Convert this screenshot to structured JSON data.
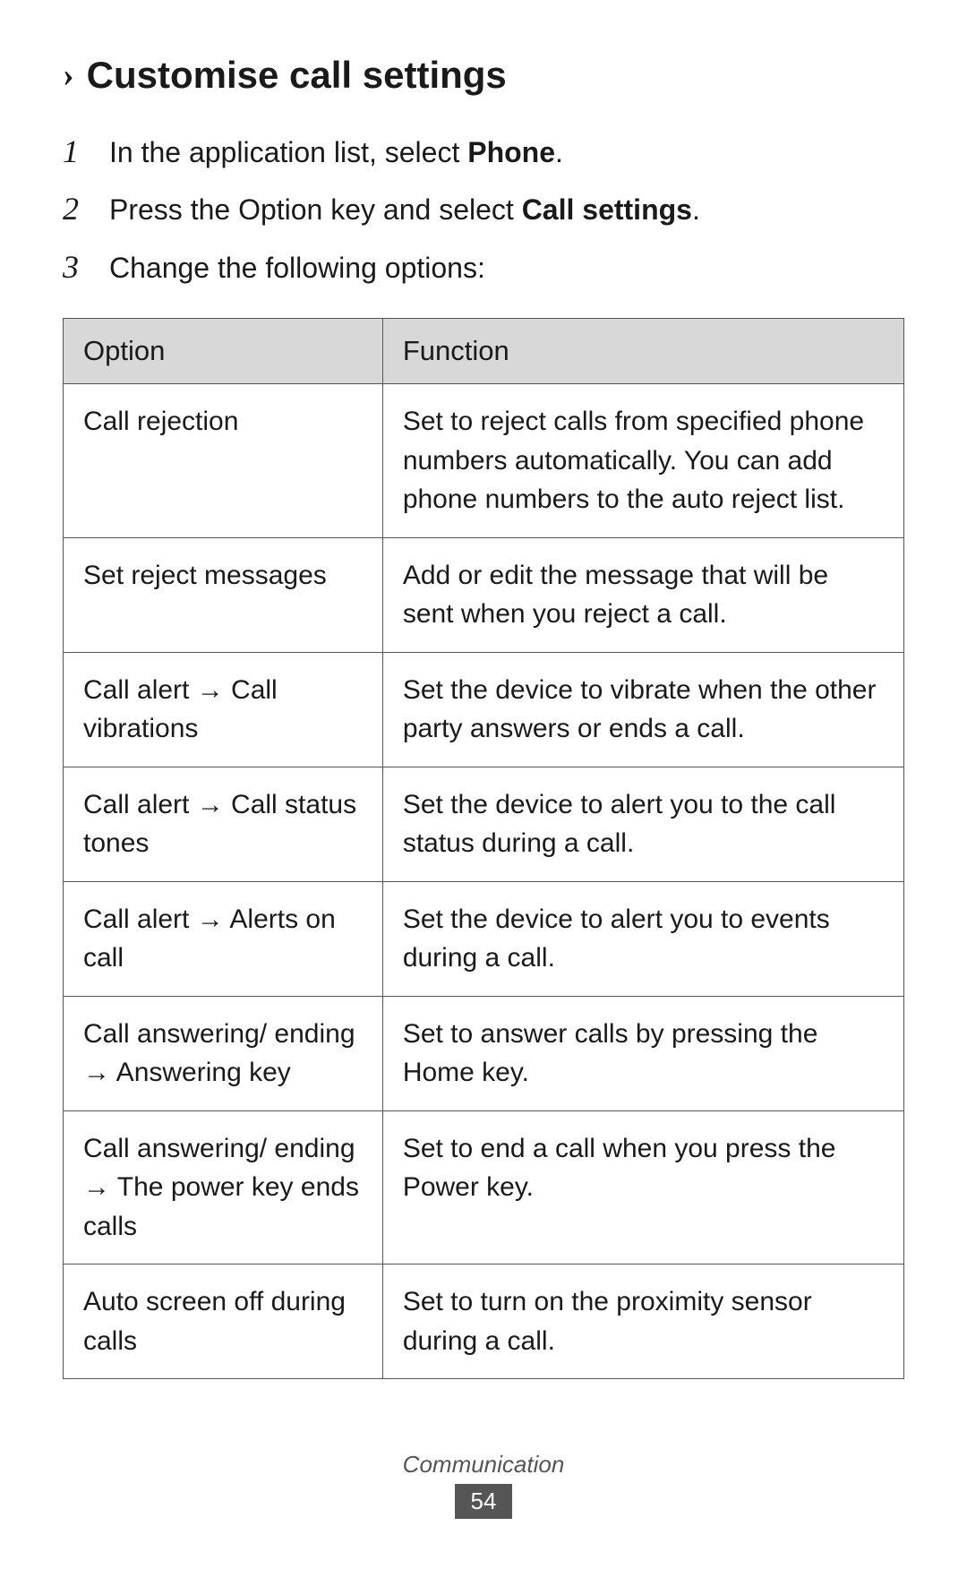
{
  "page": {
    "heading": {
      "chevron": "›",
      "title": "Customise call settings"
    },
    "steps": [
      {
        "number": "1",
        "text_before": "In the application list, select ",
        "bold": "Phone",
        "text_after": "."
      },
      {
        "number": "2",
        "text_before": "Press the Option key and select ",
        "bold": "Call settings",
        "text_after": "."
      },
      {
        "number": "3",
        "text_plain": "Change the following options:"
      }
    ],
    "table": {
      "headers": [
        "Option",
        "Function"
      ],
      "rows": [
        {
          "option": "Call rejection",
          "function": "Set to reject calls from specified phone numbers automatically. You can add phone numbers to the auto reject list."
        },
        {
          "option": "Set reject messages",
          "function": "Add or edit the message that will be sent when you reject a call."
        },
        {
          "option": "Call alert → Call vibrations",
          "function": "Set the device to vibrate when the other party answers or ends a call."
        },
        {
          "option": "Call alert → Call status tones",
          "function": "Set the device to alert you to the call status during a call."
        },
        {
          "option": "Call alert → Alerts on call",
          "function": "Set the device to alert you to events during a call."
        },
        {
          "option": "Call answering/ ending → Answering key",
          "function": "Set to answer calls by pressing the Home key."
        },
        {
          "option": "Call answering/ ending → The power key ends calls",
          "function": "Set to end a call when you press the Power key."
        },
        {
          "option": "Auto screen off during calls",
          "function": "Set to turn on the proximity sensor during a call."
        }
      ]
    },
    "footer": {
      "label": "Communication",
      "page": "54"
    }
  }
}
